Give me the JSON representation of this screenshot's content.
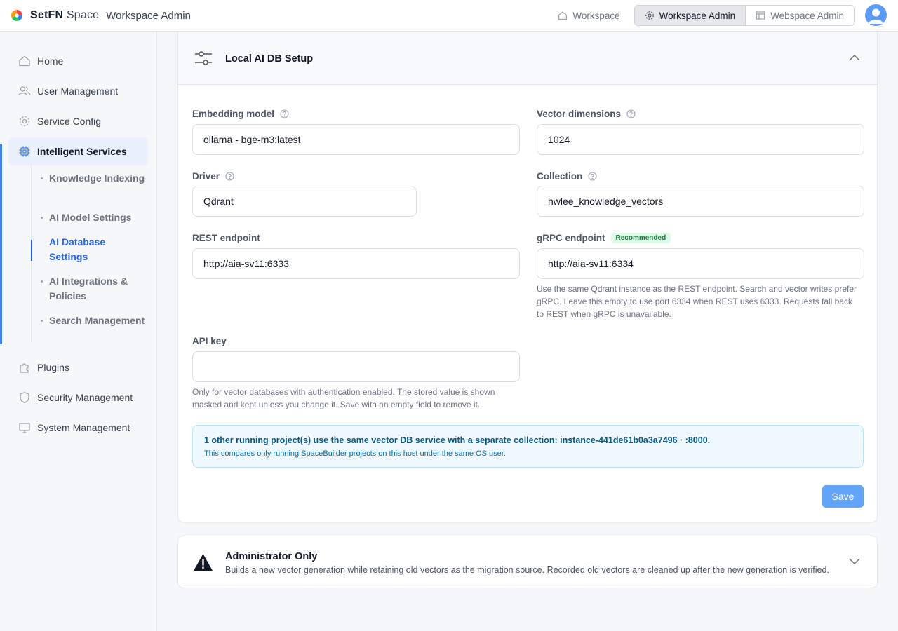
{
  "header": {
    "brand_bold": "SetFN",
    "brand_thin": "Space",
    "subtitle": "Workspace Admin",
    "nav": {
      "workspace": "Workspace",
      "workspace_admin": "Workspace Admin",
      "webspace_admin": "Webspace Admin"
    }
  },
  "sidebar": {
    "items": [
      {
        "label": "Home",
        "icon": "home-icon"
      },
      {
        "label": "User Management",
        "icon": "users-icon"
      },
      {
        "label": "Service Config",
        "icon": "gear-icon"
      },
      {
        "label": "Intelligent Services",
        "icon": "chip-icon"
      },
      {
        "label": "Plugins",
        "icon": "puzzle-icon"
      },
      {
        "label": "Security Management",
        "icon": "shield-icon"
      },
      {
        "label": "System Management",
        "icon": "monitor-icon"
      }
    ],
    "subitems": [
      {
        "label": "Knowledge Indexing"
      },
      {
        "label": "AI Model Settings"
      },
      {
        "label": "AI Database Settings"
      },
      {
        "label": "AI Integrations & Policies"
      },
      {
        "label": "Search Management"
      }
    ]
  },
  "card": {
    "title": "Local AI DB Setup",
    "fields": {
      "embedding_model": {
        "label": "Embedding model",
        "value": "ollama - bge-m3:latest"
      },
      "vector_dimensions": {
        "label": "Vector dimensions",
        "value": "1024"
      },
      "driver": {
        "label": "Driver",
        "value": "Qdrant"
      },
      "collection": {
        "label": "Collection",
        "value": "hwlee_knowledge_vectors"
      },
      "rest_endpoint": {
        "label": "REST endpoint",
        "value": "http://aia-sv11:6333"
      },
      "grpc_endpoint": {
        "label": "gRPC endpoint",
        "badge": "Recommended",
        "value": "http://aia-sv11:6334",
        "help": "Use the same Qdrant instance as the REST endpoint. Search and vector writes prefer gRPC. Leave this empty to use port 6334 when REST uses 6333. Requests fall back to REST when gRPC is unavailable."
      },
      "api_key": {
        "label": "API key",
        "value": "",
        "help": "Only for vector databases with authentication enabled. The stored value is shown masked and kept unless you change it. Save with an empty field to remove it."
      }
    },
    "info": {
      "main": "1 other running project(s) use the same vector DB service with a separate collection: instance-441de61b0a3a7496 · :8000.",
      "sub": "This compares only running SpaceBuilder projects on this host under the same OS user."
    },
    "save_label": "Save"
  },
  "admin": {
    "title": "Administrator Only",
    "desc": "Builds a new vector generation while retaining old vectors as the migration source. Recorded old vectors are cleaned up after the new generation is verified."
  },
  "colors": {
    "accent": "#2563eb",
    "save": "#60a5fa",
    "badge_bg": "#dcfce7",
    "info_bg": "#eff8fd"
  }
}
